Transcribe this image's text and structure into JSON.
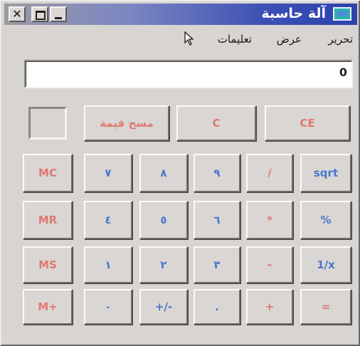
{
  "window": {
    "title": "آلة حاسبة"
  },
  "menu": {
    "edit": "تحرير",
    "view": "عرض",
    "help": "تعليمات"
  },
  "display": {
    "value": "0"
  },
  "top_keys": [
    {
      "label": "مسح قيمة",
      "color": "red"
    },
    {
      "label": "C",
      "color": "red"
    },
    {
      "label": "CE",
      "color": "red"
    }
  ],
  "rows": [
    [
      {
        "label": "MC",
        "color": "red"
      },
      {
        "label": "٧",
        "color": "blue"
      },
      {
        "label": "٨",
        "color": "blue"
      },
      {
        "label": "٩",
        "color": "blue"
      },
      {
        "label": "/",
        "color": "red"
      },
      {
        "label": "sqrt",
        "color": "blue"
      }
    ],
    [
      {
        "label": "MR",
        "color": "red"
      },
      {
        "label": "٤",
        "color": "blue"
      },
      {
        "label": "٥",
        "color": "blue"
      },
      {
        "label": "٦",
        "color": "blue"
      },
      {
        "label": "*",
        "color": "red"
      },
      {
        "label": "%",
        "color": "blue"
      }
    ],
    [
      {
        "label": "MS",
        "color": "red"
      },
      {
        "label": "١",
        "color": "blue"
      },
      {
        "label": "٢",
        "color": "blue"
      },
      {
        "label": "٣",
        "color": "blue"
      },
      {
        "label": "-",
        "color": "red"
      },
      {
        "label": "1/x",
        "color": "blue"
      }
    ],
    [
      {
        "label": "M+",
        "color": "red"
      },
      {
        "label": "٠",
        "color": "blue"
      },
      {
        "label": "+/-",
        "color": "blue"
      },
      {
        "label": ".",
        "color": "blue"
      },
      {
        "label": "+",
        "color": "red"
      },
      {
        "label": "=",
        "color": "red"
      }
    ]
  ]
}
